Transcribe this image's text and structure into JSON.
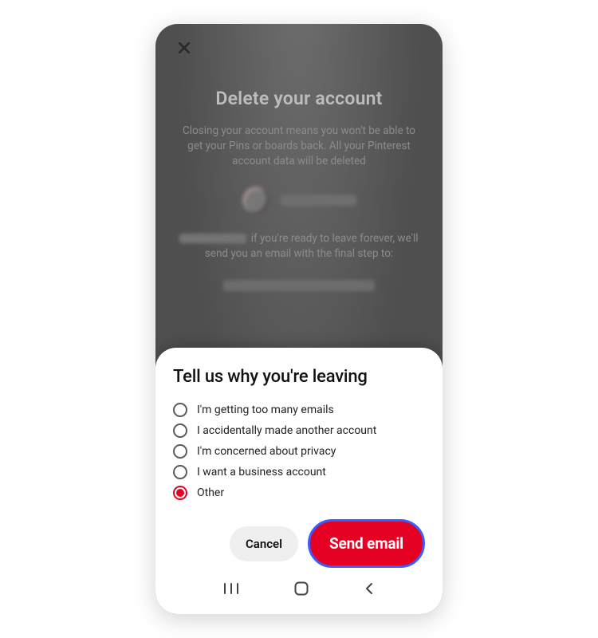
{
  "colors": {
    "accent": "#e60023",
    "focus_ring": "#3d5cff"
  },
  "back": {
    "title": "Delete your account",
    "description": "Closing your account means you won't be able to get your Pins or boards back. All your Pinterest account data will be deleted",
    "ready_text_suffix": " if you're ready to leave forever, we'll send you an email with the final step to:"
  },
  "sheet": {
    "title": "Tell us why you're leaving",
    "options": [
      {
        "label": "I'm getting too many emails",
        "selected": false
      },
      {
        "label": "I accidentally made another account",
        "selected": false
      },
      {
        "label": "I'm concerned about privacy",
        "selected": false
      },
      {
        "label": "I want a business account",
        "selected": false
      },
      {
        "label": "Other",
        "selected": true
      }
    ],
    "actions": {
      "cancel": "Cancel",
      "send": "Send email"
    }
  }
}
